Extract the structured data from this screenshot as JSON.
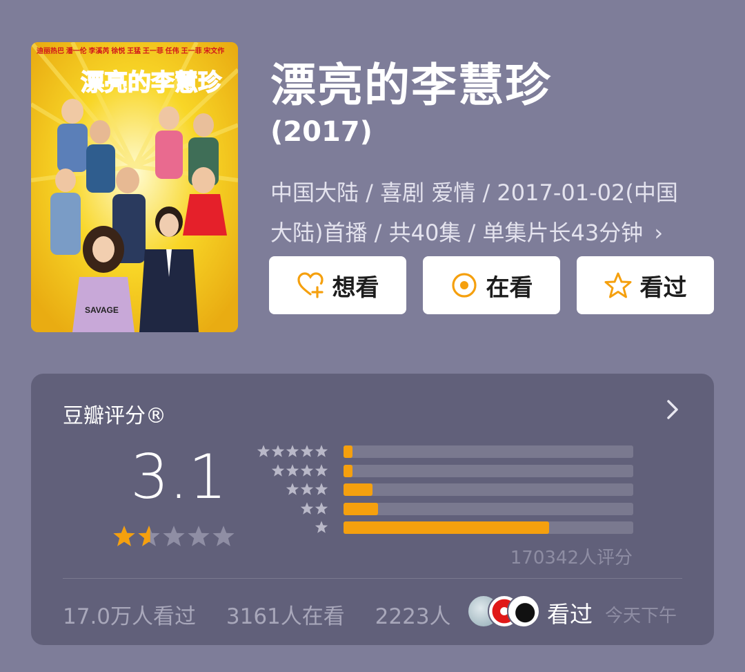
{
  "show": {
    "title": "漂亮的李慧珍",
    "year": "(2017)",
    "meta_line1": "中国大陆 / 喜剧 爱情 / 2017-01-02(中国",
    "meta_line2": "大陆)首播 / 共40集 / 单集片长43分钟",
    "meta_more": "›"
  },
  "poster": {
    "title_text": "漂亮的李慧珍",
    "top_names": "迪丽热巴   潘一伦  李溪芮 徐悦 王猛 王一菲 任伟 王一菲 宋文作",
    "shirt_text": "SAVAGE"
  },
  "actions": {
    "want": "想看",
    "watching": "在看",
    "watched": "看过"
  },
  "rating": {
    "header": "豆瓣评分®",
    "score": "3.1",
    "score_fraction": 0.31,
    "distribution": [
      {
        "stars": 5,
        "percent": 3
      },
      {
        "stars": 4,
        "percent": 3
      },
      {
        "stars": 3,
        "percent": 10
      },
      {
        "stars": 2,
        "percent": 12
      },
      {
        "stars": 1,
        "percent": 71
      }
    ],
    "count": "170342人评分"
  },
  "stats": {
    "watched": "17.0万人看过",
    "watching": "3161人在看",
    "want_partial": "2223人",
    "seen_label": "看过",
    "time_label": "今天下午"
  },
  "colors": {
    "background": "#7e7d99",
    "card": "#61607a",
    "accent": "#f5a00e"
  }
}
